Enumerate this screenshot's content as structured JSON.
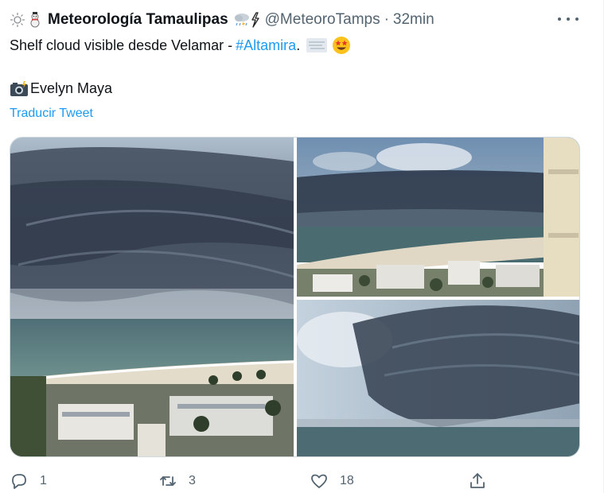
{
  "tweet": {
    "author": {
      "name": "Meteorología Tamaulipas",
      "handle": "@MeteoroTamps",
      "time": "32min",
      "leading_icons": [
        "sun-icon",
        "snowman-icon"
      ],
      "trailing_icons": [
        "cloud-storm-icon",
        "lightning-icon"
      ]
    },
    "text": {
      "body": "Shelf cloud visible desde Velamar -",
      "hashtag": "#Altamira",
      "period": ".",
      "trailing_icons": [
        "fog-icon",
        "star-struck-icon"
      ],
      "credit": "Evelyn Maya",
      "credit_icon": "camera-flash-icon"
    },
    "translate_label": "Traducir Tweet",
    "media": [
      {
        "name": "shelf-cloud-photo-beach"
      },
      {
        "name": "shelf-cloud-photo-coast"
      },
      {
        "name": "shelf-cloud-photo-sea"
      }
    ],
    "actions": {
      "reply_count": "1",
      "retweet_count": "3",
      "like_count": "18"
    },
    "colors": {
      "text": "#0f1419",
      "secondary": "#536471",
      "link": "#1d9bf0"
    }
  }
}
